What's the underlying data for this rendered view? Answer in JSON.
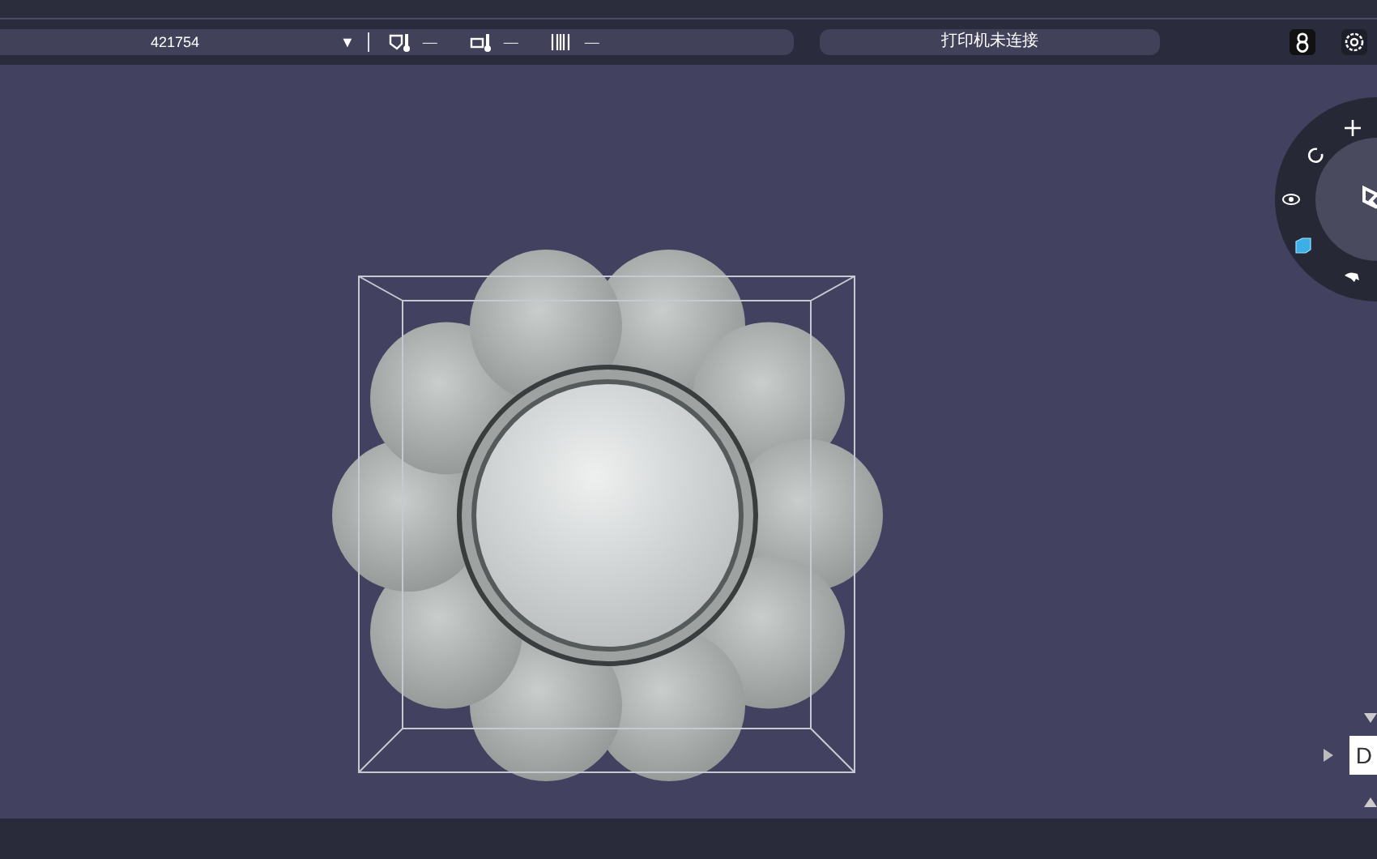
{
  "toolbar": {
    "printer_select": {
      "value": "421754",
      "caret": "▼"
    },
    "readings": [
      {
        "kind": "nozzle",
        "value": "—"
      },
      {
        "kind": "bed",
        "value": "—"
      },
      {
        "kind": "filament",
        "value": "—"
      }
    ],
    "status": "打印机未连接"
  },
  "view_cube": {
    "label": "D"
  }
}
